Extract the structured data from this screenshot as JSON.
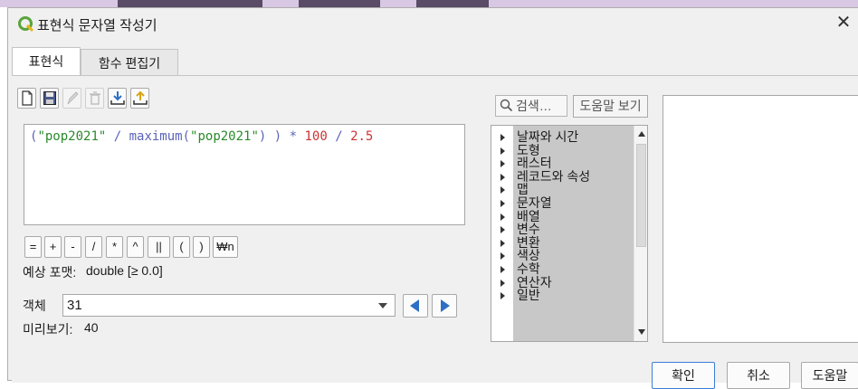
{
  "window": {
    "title": "표현식 문자열 작성기",
    "close_glyph": "✕"
  },
  "tabs": [
    {
      "label": "표현식"
    },
    {
      "label": "함수 편집기"
    }
  ],
  "toolbar": {
    "icons": [
      "new-file-icon",
      "save-icon",
      "edit-icon",
      "delete-icon",
      "import-icon",
      "export-icon"
    ]
  },
  "expression": {
    "tokens": [
      {
        "text": "(",
        "kind": "paren"
      },
      {
        "text": "\"pop2021\"",
        "kind": "str"
      },
      {
        "text": " / ",
        "kind": "op"
      },
      {
        "text": "maximum(",
        "kind": "fn"
      },
      {
        "text": "\"pop2021\"",
        "kind": "str"
      },
      {
        "text": ") ) * ",
        "kind": "op"
      },
      {
        "text": "100",
        "kind": "num"
      },
      {
        "text": " / ",
        "kind": "op"
      },
      {
        "text": "2.5",
        "kind": "num"
      }
    ]
  },
  "operators": [
    "=",
    "+",
    "-",
    "/",
    "*",
    "^",
    "||",
    "(",
    ")",
    "₩n"
  ],
  "output_format": {
    "label": "예상 포맷:",
    "value": "double [≥ 0.0]"
  },
  "feature": {
    "label": "객체",
    "value": "31"
  },
  "preview": {
    "label": "미리보기:",
    "value": "40"
  },
  "search": {
    "placeholder": "검색…"
  },
  "help_button": "도움말 보기",
  "function_groups": [
    "날짜와 시간",
    "도형",
    "래스터",
    "레코드와 속성",
    "맵",
    "문자열",
    "배열",
    "변수",
    "변환",
    "색상",
    "수학",
    "연산자",
    "일반"
  ],
  "dialog_buttons": {
    "ok": "확인",
    "cancel": "취소",
    "help": "도움말"
  },
  "colors": {
    "accent": "#3b7dd8",
    "qgis_green": "#5aa43a",
    "string": "#2a8a2a",
    "number": "#cc3333",
    "operator": "#5a63b8"
  }
}
